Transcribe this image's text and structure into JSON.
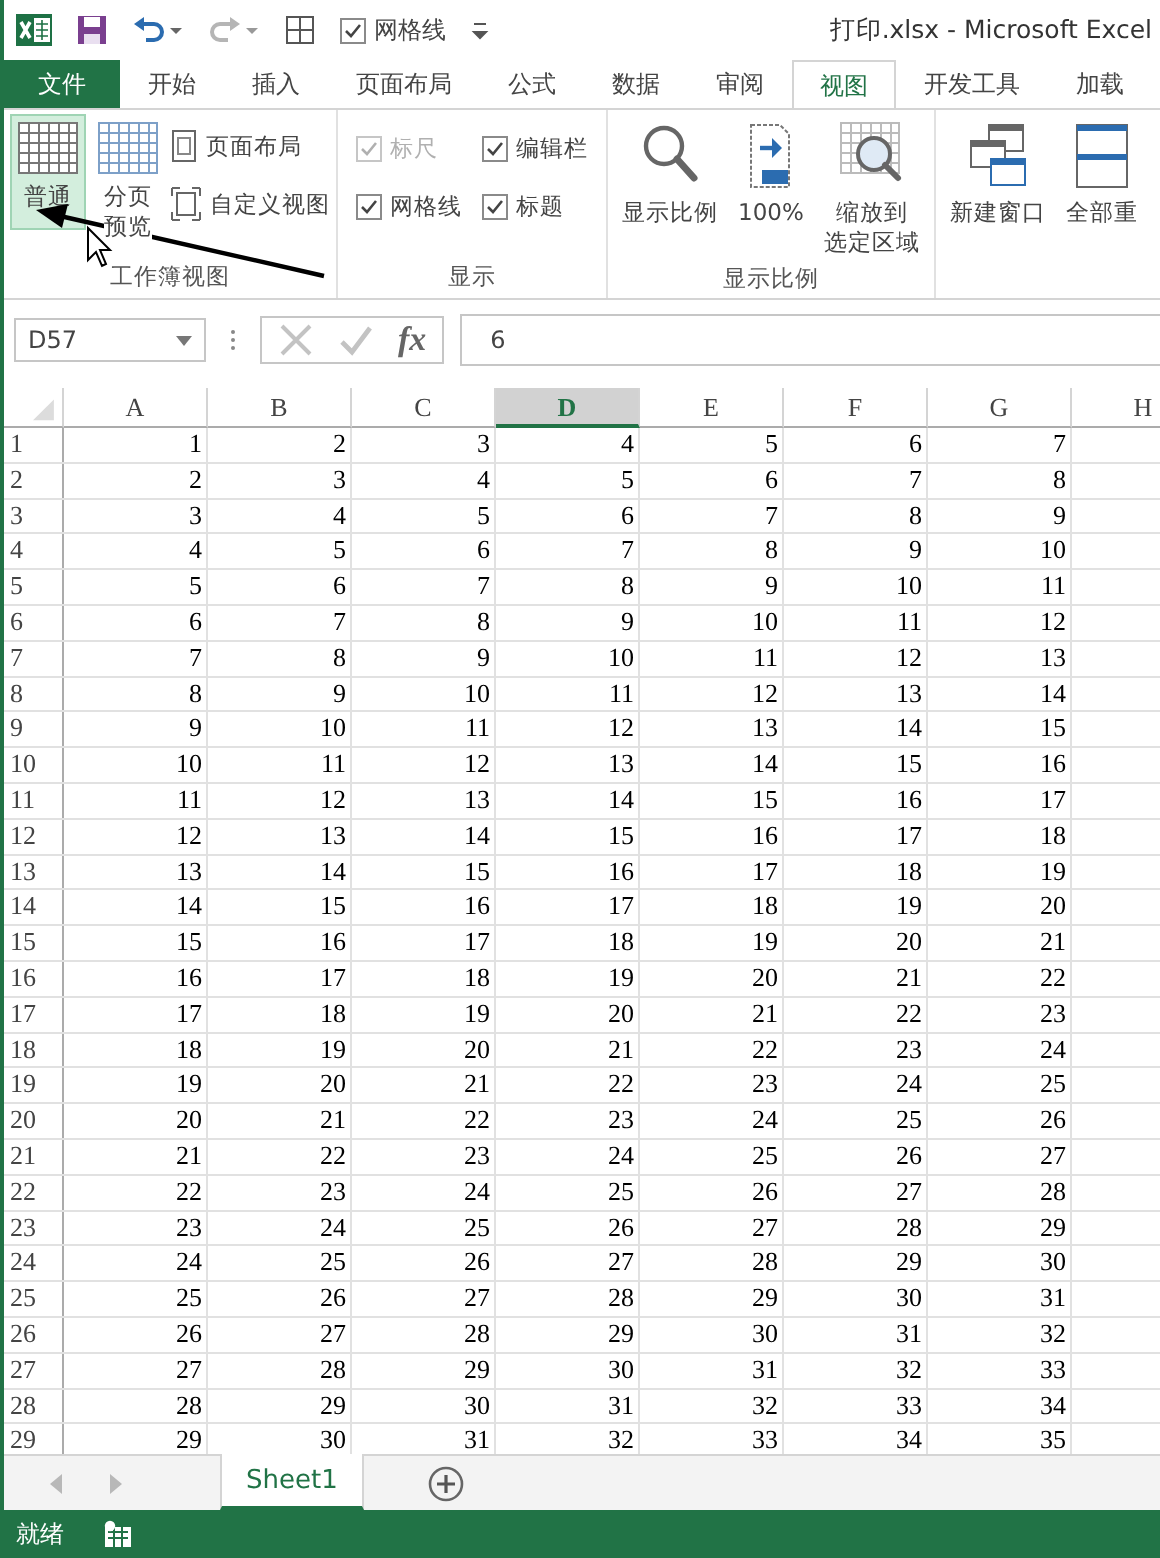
{
  "quick_access": {
    "gridlines_checkbox": {
      "label": "网格线",
      "checked": true
    },
    "redo_disabled": true
  },
  "window": {
    "title": "打印.xlsx - Microsoft Excel"
  },
  "tabs": [
    {
      "label": "文件",
      "kind": "file",
      "selected": false
    },
    {
      "label": "开始",
      "kind": "tab",
      "selected": false
    },
    {
      "label": "插入",
      "kind": "tab",
      "selected": false
    },
    {
      "label": "页面布局",
      "kind": "tab",
      "selected": false
    },
    {
      "label": "公式",
      "kind": "tab",
      "selected": false
    },
    {
      "label": "数据",
      "kind": "tab",
      "selected": false
    },
    {
      "label": "审阅",
      "kind": "tab",
      "selected": false
    },
    {
      "label": "视图",
      "kind": "tab",
      "selected": true
    },
    {
      "label": "开发工具",
      "kind": "tab",
      "selected": false
    },
    {
      "label": "加载",
      "kind": "tab",
      "selected": false
    }
  ],
  "ribbon": {
    "workbook_views": {
      "label": "工作簿视图",
      "normal": {
        "label": "普通",
        "selected": true
      },
      "page_break": {
        "line_1": "分页",
        "line_2": "预览",
        "selected": false
      },
      "page_layout": "页面布局",
      "custom_views": "自定义视图"
    },
    "show": {
      "label": "显示",
      "checkboxes": [
        {
          "label": "标尺",
          "checked": true,
          "disabled": true
        },
        {
          "label": "编辑栏",
          "checked": true,
          "disabled": false
        },
        {
          "label": "网格线",
          "checked": true,
          "disabled": false
        },
        {
          "label": "标题",
          "checked": true,
          "disabled": false
        }
      ]
    },
    "zoom": {
      "label": "显示比例",
      "zoom": "显示比例",
      "hundred": "100%",
      "zoom_to_selection": [
        "缩放到",
        "选定区域"
      ]
    },
    "window": {
      "new_window": "新建窗口",
      "arrange_all": "全部重"
    }
  },
  "formula_bar": {
    "name_box": "D57",
    "function_label": "fx",
    "value": "6"
  },
  "columns": [
    {
      "label": "A",
      "selected": false
    },
    {
      "label": "B",
      "selected": false
    },
    {
      "label": "C",
      "selected": false
    },
    {
      "label": "D",
      "selected": true
    },
    {
      "label": "E",
      "selected": false
    },
    {
      "label": "F",
      "selected": false
    },
    {
      "label": "G",
      "selected": false
    },
    {
      "label": "H",
      "selected": false
    }
  ],
  "rows": [
    {
      "header": "1",
      "cells": [
        "1",
        "2",
        "3",
        "4",
        "5",
        "6",
        "7"
      ]
    },
    {
      "header": "2",
      "cells": [
        "2",
        "3",
        "4",
        "5",
        "6",
        "7",
        "8"
      ]
    },
    {
      "header": "3",
      "cells": [
        "3",
        "4",
        "5",
        "6",
        "7",
        "8",
        "9"
      ]
    },
    {
      "header": "4",
      "cells": [
        "4",
        "5",
        "6",
        "7",
        "8",
        "9",
        "10"
      ]
    },
    {
      "header": "5",
      "cells": [
        "5",
        "6",
        "7",
        "8",
        "9",
        "10",
        "11"
      ]
    },
    {
      "header": "6",
      "cells": [
        "6",
        "7",
        "8",
        "9",
        "10",
        "11",
        "12"
      ]
    },
    {
      "header": "7",
      "cells": [
        "7",
        "8",
        "9",
        "10",
        "11",
        "12",
        "13"
      ]
    },
    {
      "header": "8",
      "cells": [
        "8",
        "9",
        "10",
        "11",
        "12",
        "13",
        "14"
      ]
    },
    {
      "header": "9",
      "cells": [
        "9",
        "10",
        "11",
        "12",
        "13",
        "14",
        "15"
      ]
    },
    {
      "header": "10",
      "cells": [
        "10",
        "11",
        "12",
        "13",
        "14",
        "15",
        "16"
      ]
    },
    {
      "header": "11",
      "cells": [
        "11",
        "12",
        "13",
        "14",
        "15",
        "16",
        "17"
      ]
    },
    {
      "header": "12",
      "cells": [
        "12",
        "13",
        "14",
        "15",
        "16",
        "17",
        "18"
      ]
    },
    {
      "header": "13",
      "cells": [
        "13",
        "14",
        "15",
        "16",
        "17",
        "18",
        "19"
      ]
    },
    {
      "header": "14",
      "cells": [
        "14",
        "15",
        "16",
        "17",
        "18",
        "19",
        "20"
      ]
    },
    {
      "header": "15",
      "cells": [
        "15",
        "16",
        "17",
        "18",
        "19",
        "20",
        "21"
      ]
    },
    {
      "header": "16",
      "cells": [
        "16",
        "17",
        "18",
        "19",
        "20",
        "21",
        "22"
      ]
    },
    {
      "header": "17",
      "cells": [
        "17",
        "18",
        "19",
        "20",
        "21",
        "22",
        "23"
      ]
    },
    {
      "header": "18",
      "cells": [
        "18",
        "19",
        "20",
        "21",
        "22",
        "23",
        "24"
      ]
    },
    {
      "header": "19",
      "cells": [
        "19",
        "20",
        "21",
        "22",
        "23",
        "24",
        "25"
      ]
    },
    {
      "header": "20",
      "cells": [
        "20",
        "21",
        "22",
        "23",
        "24",
        "25",
        "26"
      ]
    },
    {
      "header": "21",
      "cells": [
        "21",
        "22",
        "23",
        "24",
        "25",
        "26",
        "27"
      ]
    },
    {
      "header": "22",
      "cells": [
        "22",
        "23",
        "24",
        "25",
        "26",
        "27",
        "28"
      ]
    },
    {
      "header": "23",
      "cells": [
        "23",
        "24",
        "25",
        "26",
        "27",
        "28",
        "29"
      ]
    },
    {
      "header": "24",
      "cells": [
        "24",
        "25",
        "26",
        "27",
        "28",
        "29",
        "30"
      ]
    },
    {
      "header": "25",
      "cells": [
        "25",
        "26",
        "27",
        "28",
        "29",
        "30",
        "31"
      ]
    },
    {
      "header": "26",
      "cells": [
        "26",
        "27",
        "28",
        "29",
        "30",
        "31",
        "32"
      ]
    },
    {
      "header": "27",
      "cells": [
        "27",
        "28",
        "29",
        "30",
        "31",
        "32",
        "33"
      ]
    },
    {
      "header": "28",
      "cells": [
        "28",
        "29",
        "30",
        "31",
        "32",
        "33",
        "34"
      ]
    },
    {
      "header": "29",
      "cells": [
        "29",
        "30",
        "31",
        "32",
        "33",
        "34",
        "35"
      ]
    }
  ],
  "sheet_tabs": [
    {
      "label": "Sheet1",
      "selected": true
    }
  ],
  "status_bar": {
    "text": "就绪"
  }
}
